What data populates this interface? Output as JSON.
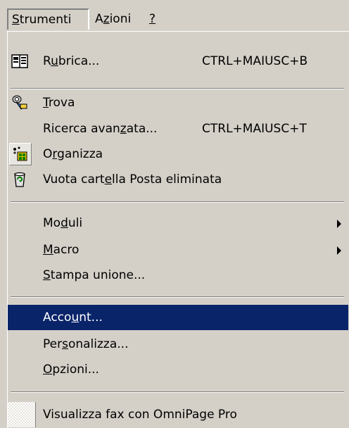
{
  "menubar": {
    "items": [
      {
        "label": "Strumenti"
      },
      {
        "label": "Azioni"
      },
      {
        "label": "?"
      }
    ]
  },
  "menu": {
    "rubrica": {
      "label": "Rubrica...",
      "shortcut": "CTRL+MAIUSC+B",
      "icon": "address-book-icon"
    },
    "trova": {
      "label": "Trova",
      "icon": "find-icon"
    },
    "ricerca": {
      "label": "Ricerca avanzata...",
      "shortcut": "CTRL+MAIUSC+T"
    },
    "organizza": {
      "label": "Organizza",
      "icon": "organize-icon"
    },
    "vuota": {
      "label": "Vuota cartella Posta eliminata",
      "icon": "recycle-bin-icon"
    },
    "moduli": {
      "label": "Moduli"
    },
    "macro": {
      "label": "Macro"
    },
    "stampa": {
      "label": "Stampa unione..."
    },
    "account": {
      "label": "Account..."
    },
    "personalizza": {
      "label": "Personalizza..."
    },
    "opzioni": {
      "label": "Opzioni..."
    },
    "visualizza": {
      "label": "Visualizza fax con OmniPage Pro"
    }
  },
  "colors": {
    "menu_bg": "#d4d0c8",
    "highlight_bg": "#0a246a",
    "highlight_text": "#ffffff"
  }
}
